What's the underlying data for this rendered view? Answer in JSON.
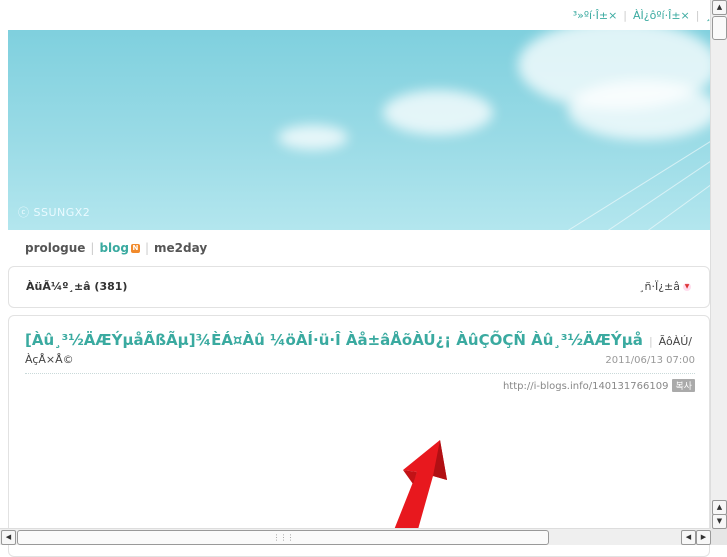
{
  "top_links": [
    "³»ºí·Î±×",
    "ÀÌ¿ôºí·Î±×",
    "¸"
  ],
  "banner": {
    "copyright": "ⓒ SSUNGX2"
  },
  "nav": {
    "items": [
      "prologue",
      "blog",
      "me2day"
    ],
    "rss_badge": "N"
  },
  "category": {
    "label": "ÀüÃ¼º¸±â",
    "count": "381",
    "list_label": "¸ñ·Ï¿­±â"
  },
  "post": {
    "title": "[Àû¸³½ÄÆÝµåÃßÃµ]¾ÈÁ¤Àû ¼öÀÍ·ü·Î Àå±âÅõÀÚ¿¡ ÀûÇÕÇÑ Àû¸³½ÄÆÝµå",
    "author_line1": "ÃôÀÚ/",
    "author_line2": "ÀçÅ×Å©",
    "date": "2011/06/13 07:00",
    "url": "http://i-blogs.info/140131766109",
    "copy_label": "복사"
  },
  "colors": {
    "accent": "#3aaaa0",
    "banner": "#8fd6e2",
    "arrow": "#e8181e"
  }
}
